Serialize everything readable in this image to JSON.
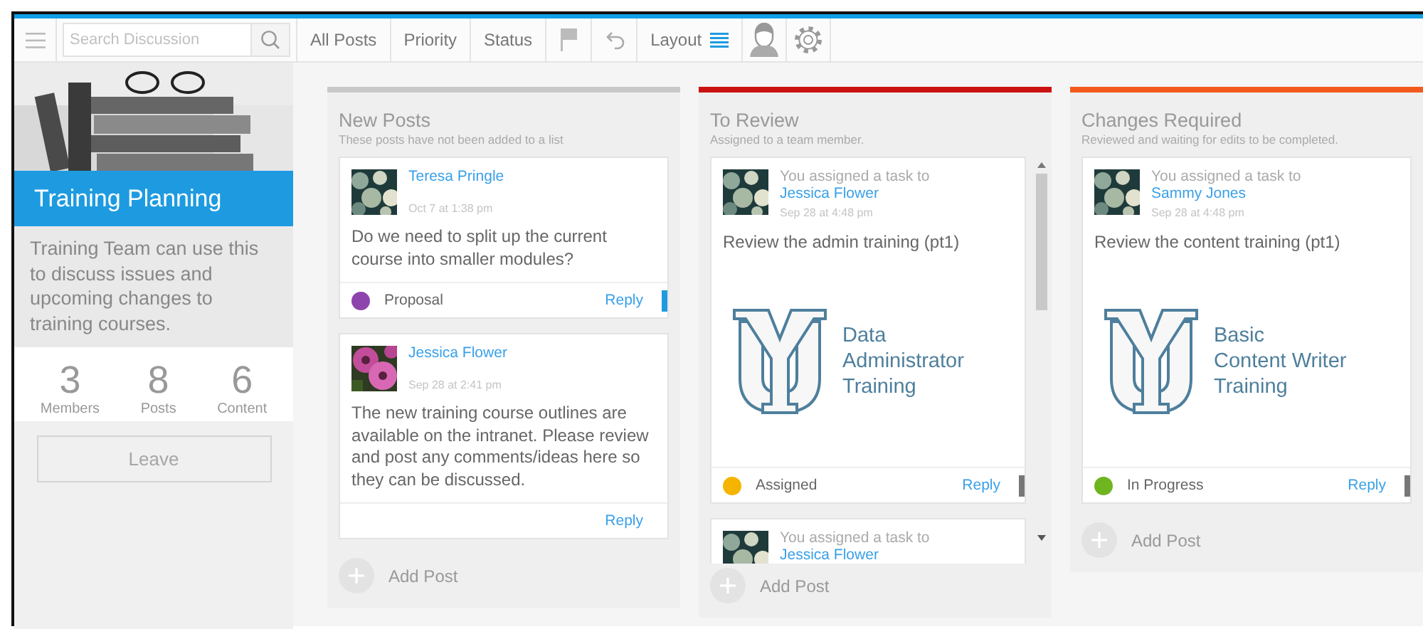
{
  "toolbar": {
    "search": {
      "placeholder": "Search Discussion"
    },
    "items": [
      {
        "kind": "text",
        "label": "All Posts"
      },
      {
        "kind": "text",
        "label": "Priority"
      },
      {
        "kind": "text",
        "label": "Status"
      },
      {
        "kind": "flag"
      },
      {
        "kind": "undo"
      },
      {
        "kind": "layout",
        "label": "Layout"
      },
      {
        "kind": "person"
      },
      {
        "kind": "gear"
      }
    ]
  },
  "sidebar": {
    "title": "Training Planning",
    "description": "Training Team can use this to discuss issues and upcoming changes to training courses.",
    "stats": [
      {
        "value": "3",
        "label": "Members"
      },
      {
        "value": "8",
        "label": "Posts"
      },
      {
        "value": "6",
        "label": "Content"
      }
    ],
    "leave_button": {
      "label": "Leave",
      "disabled": true
    }
  },
  "columns": [
    {
      "title": "New Posts",
      "subtitle": "These posts have not been added to a list",
      "color": "#c8c8c8",
      "scrollbar": false,
      "add_label": "Add Post",
      "cards": [
        {
          "kind": "post",
          "author": "Teresa Pringle",
          "date": "Oct 7 at 1:38 pm",
          "body": "Do we need to split up the current course into smaller modules?",
          "footer": {
            "status": {
              "label": "Proposal",
              "color": "#8e44ad"
            },
            "reply": "Reply",
            "marker": {
              "color": "#1e9be0"
            }
          }
        },
        {
          "kind": "post",
          "author": "Jessica Flower",
          "date": "Sep 28 at 2:41 pm",
          "body": "The new training course outlines are available on the intranet. Please review and post any comments/ideas here so they can be discussed.",
          "footer": {
            "reply": "Reply"
          }
        }
      ]
    },
    {
      "title": "To Review",
      "subtitle": "Assigned to a team member.",
      "color": "#cc1111",
      "scrollbar": true,
      "add_label": "Add Post",
      "cards": [
        {
          "kind": "task",
          "action": "You assigned a task to",
          "assignee": "Jessica Flower",
          "date": "Sep 28 at 4:48 pm",
          "body": "Review the admin training (pt1)",
          "attachment": [
            "Data",
            "Administrator",
            "Training"
          ],
          "footer": {
            "status": {
              "label": "Assigned",
              "color": "#f5b400"
            },
            "reply": "Reply",
            "marker": {
              "color": "#777777"
            }
          }
        },
        {
          "kind": "task",
          "action": "You assigned a task to",
          "assignee": "Jessica Flower"
        }
      ]
    },
    {
      "title": "Changes Required",
      "subtitle": "Reviewed and waiting for edits to be completed.",
      "color": "#f25a1d",
      "scrollbar": false,
      "add_label": "Add Post",
      "cards": [
        {
          "kind": "task",
          "action": "You assigned a task to",
          "assignee": "Sammy Jones",
          "date": "Sep 28 at 4:48 pm",
          "body": "Review the content training (pt1)",
          "attachment": [
            "Basic",
            "Content Writer",
            "Training"
          ],
          "footer": {
            "status": {
              "label": "In Progress",
              "color": "#6fb51f"
            },
            "reply": "Reply",
            "marker": {
              "color": "#777777"
            }
          }
        }
      ]
    }
  ]
}
